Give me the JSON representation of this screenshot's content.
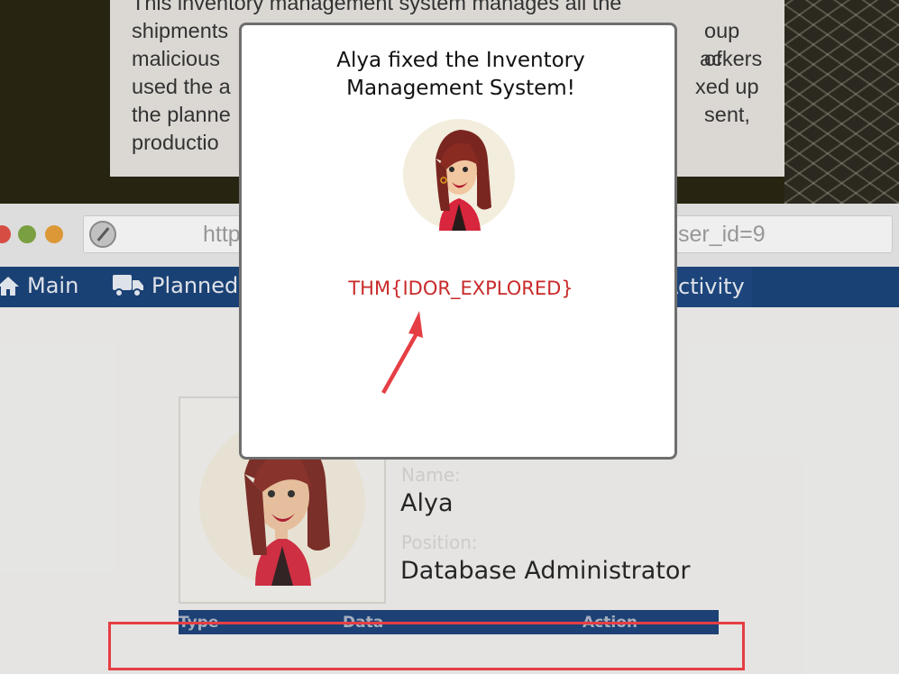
{
  "description": {
    "lines": [
      "This inventory management system manages all the",
      "shipments",
      "malicious",
      "used the a",
      "the planne",
      "productio"
    ],
    "right_fragments": [
      "oup of",
      "ackers",
      "xed up",
      "sent,"
    ]
  },
  "browser": {
    "url_left": "http",
    "url_right": "ser_id=9"
  },
  "nav": {
    "main_label": "Main",
    "planned_label": "Planned",
    "activity_label": "Activity"
  },
  "profile": {
    "name_label": "Name:",
    "name_value": "Alya",
    "position_label": "Position:",
    "position_value": "Database Administrator"
  },
  "table": {
    "columns": [
      "Type",
      "Data",
      "Action"
    ]
  },
  "modal": {
    "title": "Alya fixed the Inventory Management System!",
    "flag": "THM{IDOR_EXPLORED}"
  },
  "colors": {
    "nav_bg": "#0f3a73",
    "flag": "#c92a2a",
    "annotation": "#e53e44"
  }
}
